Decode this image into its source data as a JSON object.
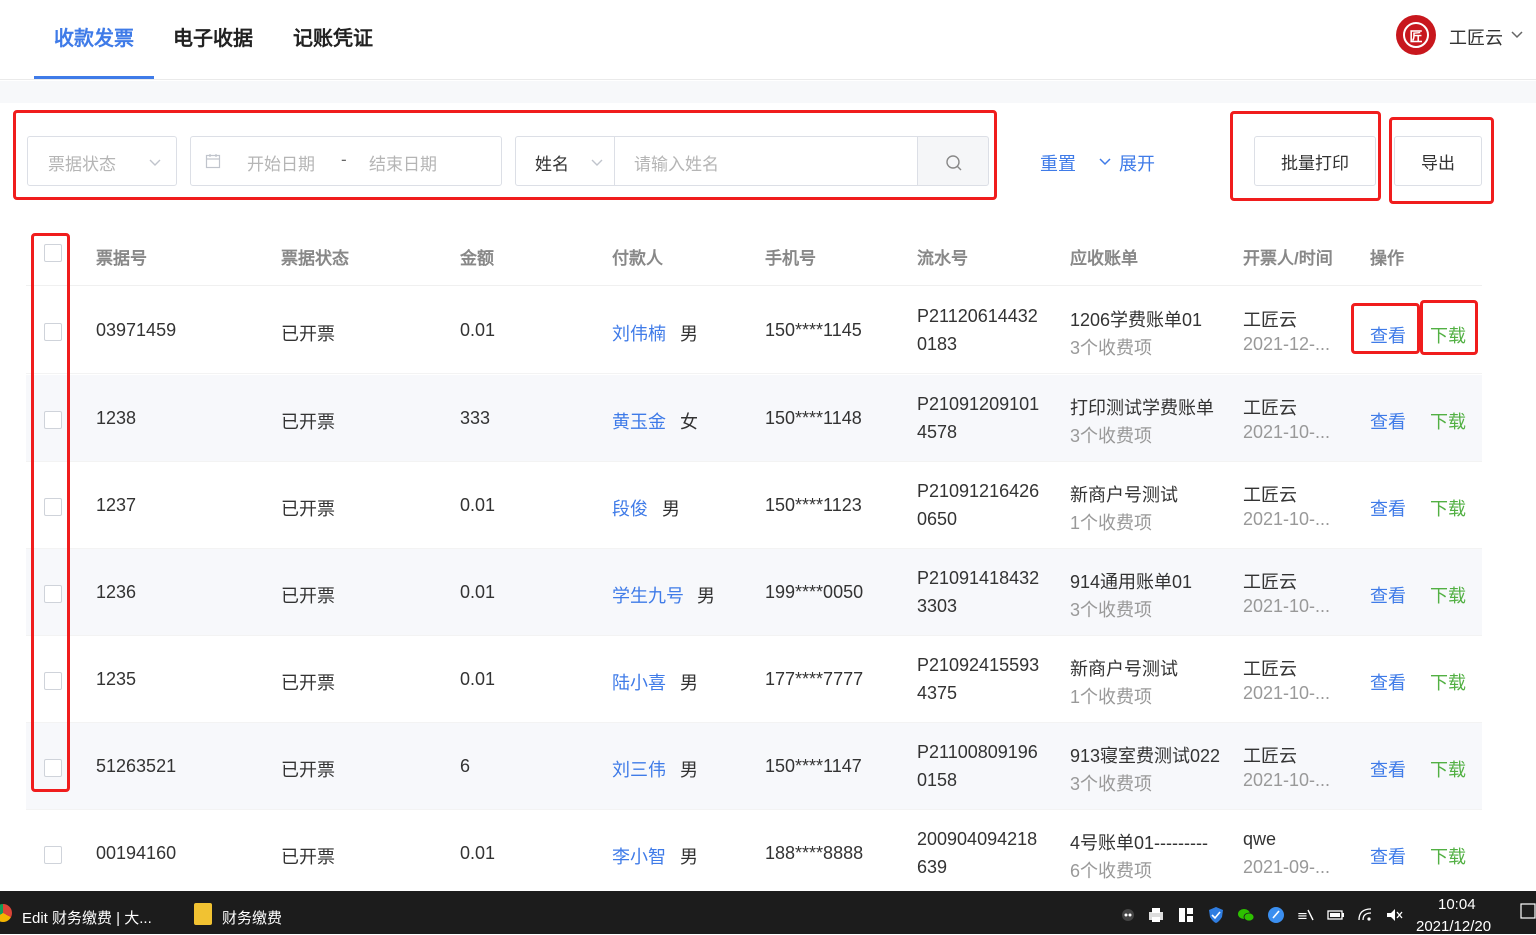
{
  "tabs": [
    {
      "label": "收款发票",
      "active": true
    },
    {
      "label": "电子收据",
      "active": false
    },
    {
      "label": "记账凭证",
      "active": false
    }
  ],
  "brand": {
    "logo_text": "匠",
    "name": "工匠云"
  },
  "filters": {
    "status_placeholder": "票据状态",
    "date_start_placeholder": "开始日期",
    "date_separator": "-",
    "date_end_placeholder": "结束日期",
    "name_field_select": "姓名",
    "name_placeholder": "请输入姓名",
    "reset_label": "重置",
    "expand_label": "展开",
    "batch_print_label": "批量打印",
    "export_label": "导出"
  },
  "table": {
    "headers": [
      "票据号",
      "票据状态",
      "金额",
      "付款人",
      "手机号",
      "流水号",
      "应收账单",
      "开票人/时间",
      "操作"
    ],
    "view_label": "查看",
    "download_label": "下载",
    "rows": [
      {
        "no": "03971459",
        "status": "已开票",
        "amount": "0.01",
        "payer": "刘伟楠",
        "gender": "男",
        "phone": "150****1145",
        "serial1": "P21120614432",
        "serial2": "0183",
        "bill": "1206学费账单01",
        "bill_sub": "3个收费项",
        "issuer": "工匠云",
        "time": "2021-12-..."
      },
      {
        "no": "1238",
        "status": "已开票",
        "amount": "333",
        "payer": "黄玉金",
        "gender": "女",
        "phone": "150****1148",
        "serial1": "P21091209101",
        "serial2": "4578",
        "bill": "打印测试学费账单",
        "bill_sub": "3个收费项",
        "issuer": "工匠云",
        "time": "2021-10-..."
      },
      {
        "no": "1237",
        "status": "已开票",
        "amount": "0.01",
        "payer": "段俊",
        "gender": "男",
        "phone": "150****1123",
        "serial1": "P21091216426",
        "serial2": "0650",
        "bill": "新商户号测试",
        "bill_sub": "1个收费项",
        "issuer": "工匠云",
        "time": "2021-10-..."
      },
      {
        "no": "1236",
        "status": "已开票",
        "amount": "0.01",
        "payer": "学生九号",
        "gender": "男",
        "phone": "199****0050",
        "serial1": "P21091418432",
        "serial2": "3303",
        "bill": "914通用账单01",
        "bill_sub": "3个收费项",
        "issuer": "工匠云",
        "time": "2021-10-..."
      },
      {
        "no": "1235",
        "status": "已开票",
        "amount": "0.01",
        "payer": "陆小喜",
        "gender": "男",
        "phone": "177****7777",
        "serial1": "P21092415593",
        "serial2": "4375",
        "bill": "新商户号测试",
        "bill_sub": "1个收费项",
        "issuer": "工匠云",
        "time": "2021-10-..."
      },
      {
        "no": "51263521",
        "status": "已开票",
        "amount": "6",
        "payer": "刘三伟",
        "gender": "男",
        "phone": "150****1147",
        "serial1": "P21100809196",
        "serial2": "0158",
        "bill": "913寝室费测试022",
        "bill_sub": "3个收费项",
        "issuer": "工匠云",
        "time": "2021-10-..."
      },
      {
        "no": "00194160",
        "status": "已开票",
        "amount": "0.01",
        "payer": "李小智",
        "gender": "男",
        "phone": "188****8888",
        "serial1": "200904094218",
        "serial2": "639",
        "bill": "4号账单01---------",
        "bill_sub": "6个收费项",
        "issuer": "qwe",
        "time": "2021-09-..."
      }
    ]
  },
  "taskbar": {
    "app1": "Edit 财务缴费 | 大...",
    "app2": "财务缴费",
    "time": "10:04",
    "date": "2021/12/20"
  },
  "colors": {
    "accent": "#3f7be8",
    "download": "#52b043",
    "highlight": "#f01d1d",
    "brand": "#c8171d"
  }
}
